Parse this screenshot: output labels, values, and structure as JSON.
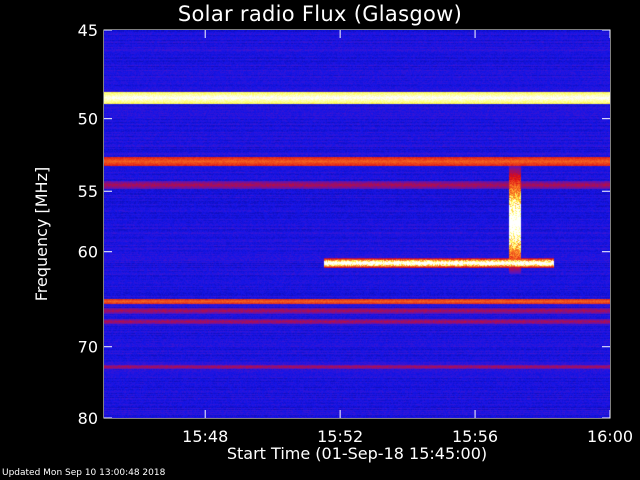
{
  "title": "Solar radio Flux (Glasgow)",
  "footer": "Updated Mon Sep 10 13:00:48 2018",
  "colors": {
    "background": "#000000",
    "low": "#1010d8",
    "mid": "#d01010",
    "high": "#ffff60"
  },
  "chart_data": {
    "type": "heatmap",
    "title": "Solar radio Flux (Glasgow)",
    "xlabel": "Start Time (01-Sep-18 15:45:00)",
    "ylabel": "Frequency [MHz]",
    "xlim": [
      "15:45",
      "16:00"
    ],
    "ylim": [
      45,
      80
    ],
    "y_inverted": true,
    "x_ticks": [
      "15:48",
      "15:52",
      "15:56",
      "16:00"
    ],
    "y_ticks": [
      45,
      50,
      55,
      60,
      70,
      80
    ],
    "colormap": "blue-red-yellow-white",
    "features": [
      {
        "kind": "horizontal_band",
        "freq_mhz": 48.7,
        "intensity": "saturated"
      },
      {
        "kind": "horizontal_band",
        "freq_mhz": 52.8,
        "intensity": "high"
      },
      {
        "kind": "horizontal_band",
        "freq_mhz": 54.5,
        "intensity": "medium"
      },
      {
        "kind": "horizontal_band",
        "freq_mhz": 64.8,
        "intensity": "high"
      },
      {
        "kind": "horizontal_band",
        "freq_mhz": 65.8,
        "intensity": "medium"
      },
      {
        "kind": "horizontal_band",
        "freq_mhz": 67.0,
        "intensity": "medium"
      },
      {
        "kind": "horizontal_band",
        "freq_mhz": 72.5,
        "intensity": "medium"
      },
      {
        "kind": "burst",
        "time_start": "15:51:30",
        "time_end": "15:58:20",
        "freq_mhz_low": 60.5,
        "freq_mhz_high": 61.5,
        "intensity": "high"
      },
      {
        "kind": "burst",
        "time_start": "15:57:00",
        "time_end": "15:57:20",
        "freq_mhz_low": 53.0,
        "freq_mhz_high": 62.0,
        "intensity": "high"
      }
    ]
  }
}
